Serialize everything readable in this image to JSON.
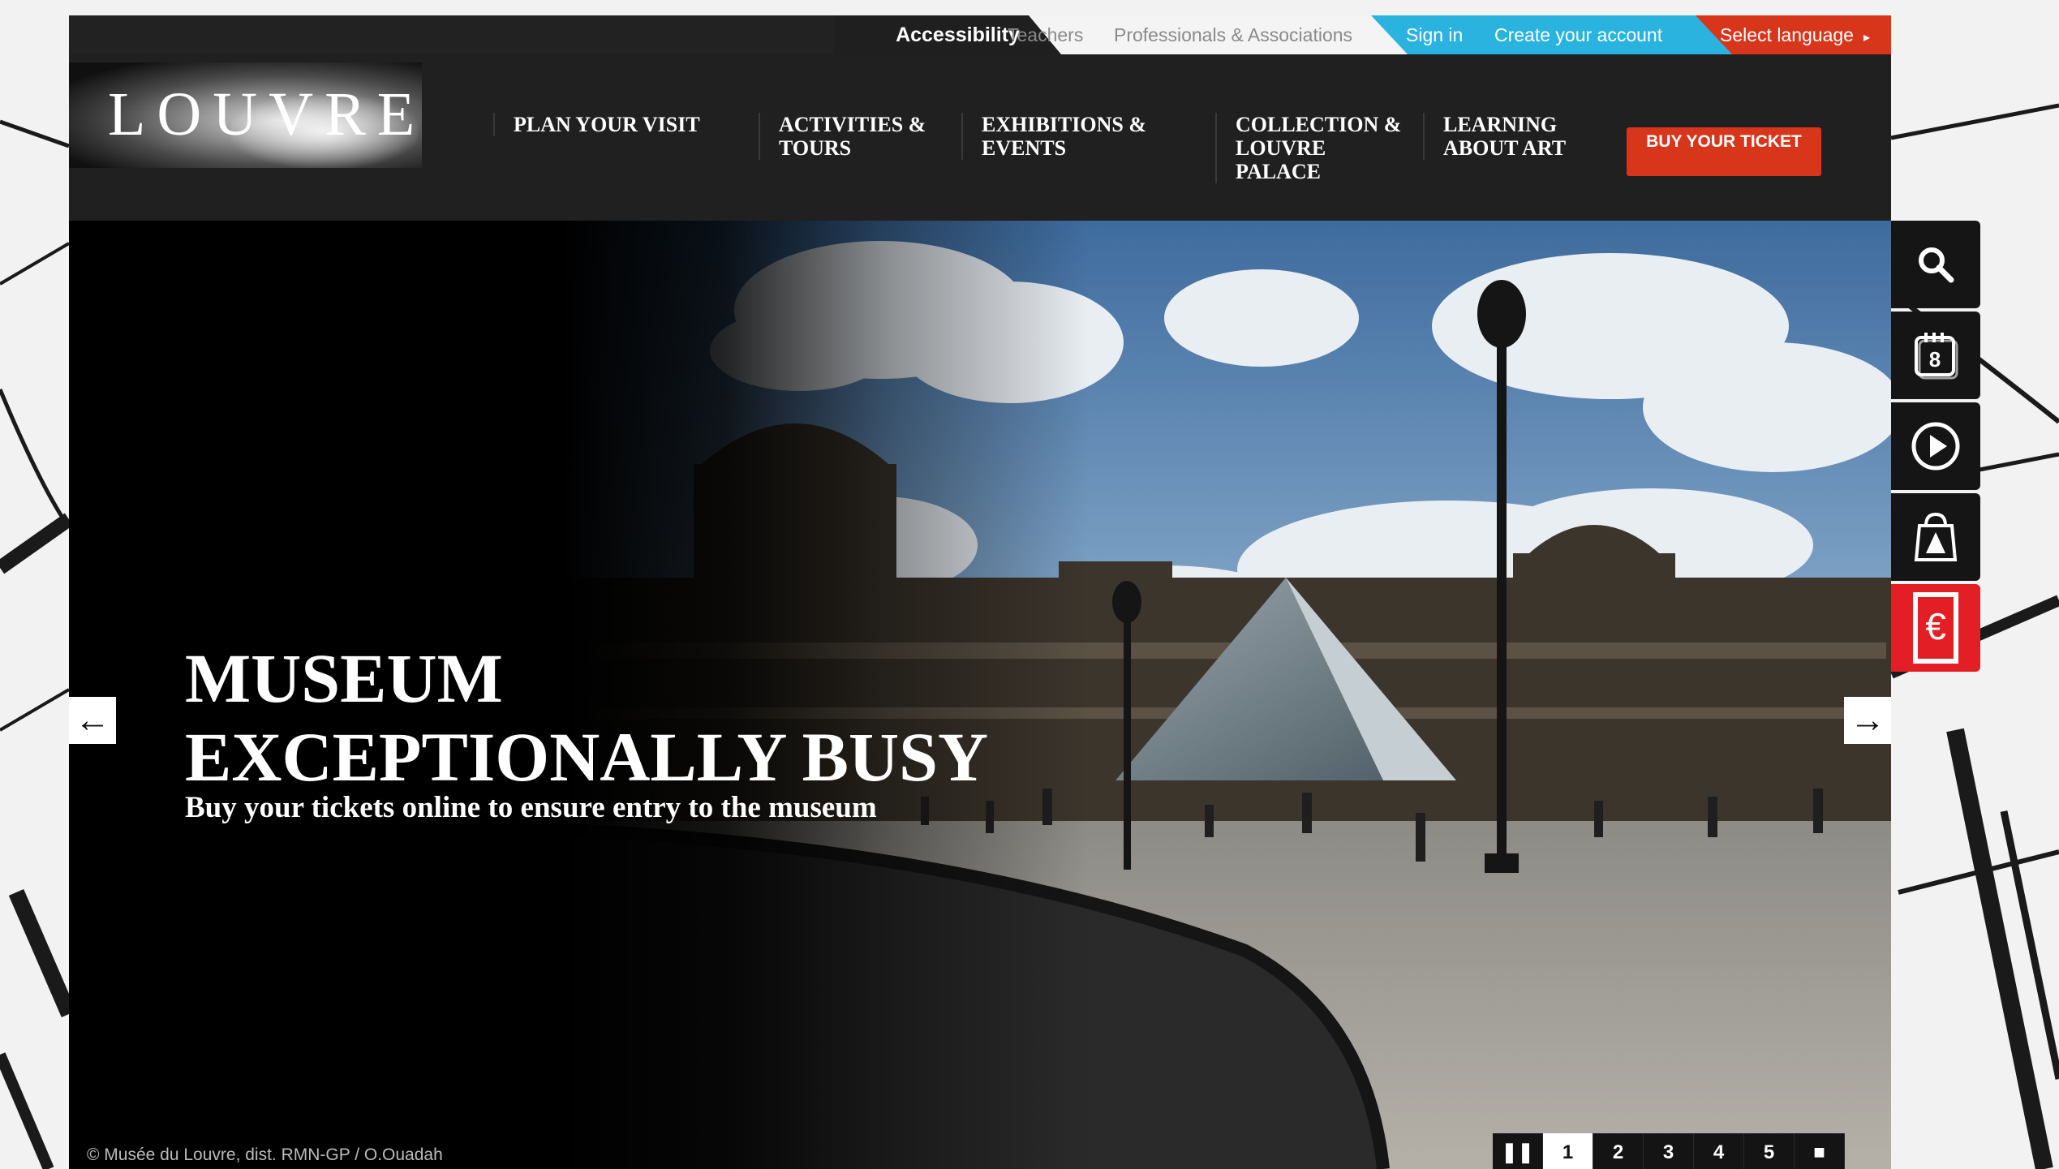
{
  "utility_bar": {
    "accessibility": "Accessibility",
    "teachers": "Teachers",
    "professionals": "Professionals & Associations",
    "sign_in": "Sign in",
    "create_account": "Create your account",
    "select_language": "Select language"
  },
  "header": {
    "logo_text": "LOUVRE",
    "nav": [
      {
        "label": "PLAN YOUR VISIT"
      },
      {
        "label": "ACTIVITIES & TOURS"
      },
      {
        "label": "EXHIBITIONS & EVENTS"
      },
      {
        "label": "COLLECTION & LOUVRE PALACE"
      },
      {
        "label": "LEARNING ABOUT ART"
      }
    ],
    "buy_ticket": "BUY YOUR TICKET"
  },
  "hero": {
    "title": "MUSEUM EXCEPTIONALLY BUSY",
    "subtitle": "Buy your tickets online to ensure entry to the museum",
    "credit": "© Musée du Louvre, dist. RMN-GP / O.Ouadah",
    "pager": [
      "1",
      "2",
      "3",
      "4",
      "5"
    ],
    "active_slide": "1"
  },
  "side_tools": [
    {
      "icon": "search-icon"
    },
    {
      "icon": "calendar-icon",
      "text": "8"
    },
    {
      "icon": "play-icon"
    },
    {
      "icon": "shopping-bag-icon"
    },
    {
      "icon": "euro-ticket-icon",
      "text": "€"
    }
  ],
  "colors": {
    "accent_red": "#d8361b",
    "accent_blue": "#2ab3df",
    "header_bg": "#202020",
    "euro_red": "#e31e24"
  }
}
